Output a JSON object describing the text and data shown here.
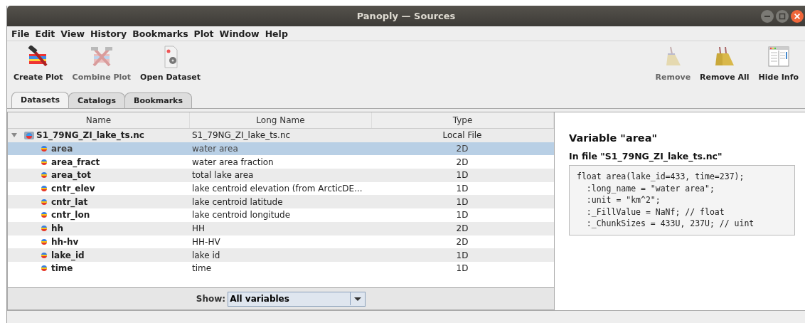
{
  "window": {
    "title": "Panoply — Sources"
  },
  "menu": [
    "File",
    "Edit",
    "View",
    "History",
    "Bookmarks",
    "Plot",
    "Window",
    "Help"
  ],
  "toolbar_left": [
    {
      "label": "Create Plot",
      "kind": "create",
      "disabled": false
    },
    {
      "label": "Combine Plot",
      "kind": "combine",
      "disabled": true
    },
    {
      "label": "Open Dataset",
      "kind": "open",
      "disabled": false
    }
  ],
  "toolbar_right": [
    {
      "label": "Remove",
      "kind": "broom",
      "disabled": true
    },
    {
      "label": "Remove All",
      "kind": "brooms",
      "disabled": false
    },
    {
      "label": "Hide Info",
      "kind": "info",
      "disabled": false
    }
  ],
  "tabs": [
    {
      "label": "Datasets",
      "selected": true
    },
    {
      "label": "Catalogs",
      "selected": false
    },
    {
      "label": "Bookmarks",
      "selected": false
    }
  ],
  "table": {
    "columns": [
      "Name",
      "Long Name",
      "Type"
    ],
    "root": {
      "name": "S1_79NG_ZI_lake_ts.nc",
      "long_name": "S1_79NG_ZI_lake_ts.nc",
      "type": "Local File",
      "expanded": true,
      "children": [
        {
          "name": "area",
          "long_name": "water area",
          "type": "2D",
          "selected": true
        },
        {
          "name": "area_fract",
          "long_name": "water area fraction",
          "type": "2D",
          "selected": false
        },
        {
          "name": "area_tot",
          "long_name": "total lake area",
          "type": "1D",
          "selected": false
        },
        {
          "name": "cntr_elev",
          "long_name": "lake centroid elevation (from ArcticDE...",
          "type": "1D",
          "selected": false
        },
        {
          "name": "cntr_lat",
          "long_name": "lake centroid latitude",
          "type": "1D",
          "selected": false
        },
        {
          "name": "cntr_lon",
          "long_name": "lake centroid longitude",
          "type": "1D",
          "selected": false
        },
        {
          "name": "hh",
          "long_name": "HH",
          "type": "2D",
          "selected": false
        },
        {
          "name": "hh-hv",
          "long_name": "HH-HV",
          "type": "2D",
          "selected": false
        },
        {
          "name": "lake_id",
          "long_name": "lake id",
          "type": "1D",
          "selected": false
        },
        {
          "name": "time",
          "long_name": "time",
          "type": "1D",
          "selected": false
        }
      ]
    }
  },
  "show": {
    "label": "Show:",
    "value": "All variables"
  },
  "info": {
    "title": "Variable \"area\"",
    "subtitle": "In file \"S1_79NG_ZI_lake_ts.nc\"",
    "code": [
      "float area(lake_id=433, time=237);",
      "  :long_name = \"water area\";",
      "  :unit = \"km^2\";",
      "  :_FillValue = NaNf; // float",
      "  :_ChunkSizes = 433U, 237U; // uint"
    ]
  }
}
